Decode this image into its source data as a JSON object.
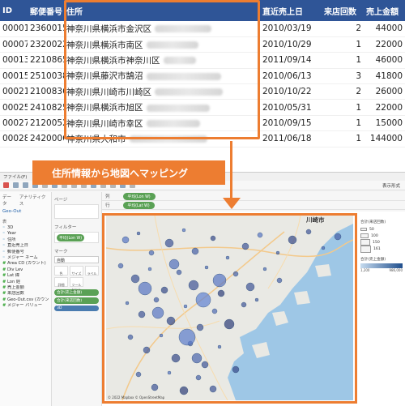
{
  "sheet": {
    "columns": [
      "ID",
      "郵便番号",
      "住所",
      "直近売上日",
      "来店回数",
      "売上金額"
    ],
    "rows": [
      {
        "id": "00001",
        "zip": "2360015",
        "addr": "神奈川県横浜市金沢区",
        "date": "2010/03/19",
        "visits": "2",
        "sales": "44000"
      },
      {
        "id": "00007",
        "zip": "2320022",
        "addr": "神奈川県横浜市南区",
        "date": "2010/10/29",
        "visits": "1",
        "sales": "22000"
      },
      {
        "id": "00013",
        "zip": "2210865",
        "addr": "神奈川県横浜市神奈川区",
        "date": "2011/09/14",
        "visits": "1",
        "sales": "46000"
      },
      {
        "id": "00015",
        "zip": "2510038",
        "addr": "神奈川県藤沢市鵠沼",
        "date": "2010/06/13",
        "visits": "3",
        "sales": "41800"
      },
      {
        "id": "00021",
        "zip": "2100836",
        "addr": "神奈川県川崎市川崎区",
        "date": "2010/10/22",
        "visits": "2",
        "sales": "26000"
      },
      {
        "id": "00025",
        "zip": "2410825",
        "addr": "神奈川県横浜市旭区",
        "date": "2010/05/31",
        "visits": "1",
        "sales": "22000"
      },
      {
        "id": "00027",
        "zip": "2120052",
        "addr": "神奈川県川崎市幸区",
        "date": "2010/09/15",
        "visits": "1",
        "sales": "15000"
      },
      {
        "id": "00028",
        "zip": "2420006",
        "addr": "神奈川県大和市",
        "date": "2011/06/18",
        "visits": "1",
        "sales": "144000"
      }
    ]
  },
  "callout": {
    "label": "住所情報から地図へマッピング",
    "color": "#ed7d31"
  },
  "app": {
    "menu": [
      "ファイル(F)"
    ],
    "show_me": "表示形式",
    "data_pane": {
      "tabs": [
        "データ",
        "アナリティクス"
      ],
      "datasource": "Geo-Out",
      "section_label": "表",
      "dimensions": [
        "3D",
        "Year",
        "住所",
        "直近売上日",
        "郵便番号",
        "メジャー ネーム"
      ],
      "measures": [
        "Area CD (カウント)",
        "Div Lev",
        "Lat 緯",
        "Lon 経",
        "売上金額",
        "来店回数",
        "Geo-Out.csv (カウント)",
        "メジャー バリュー"
      ]
    },
    "cards": {
      "pages": "ページ",
      "filters": "フィルター",
      "filter_pill": "平均(Lon W)",
      "marks": "マーク",
      "mark_type": "自動",
      "mark_buttons": [
        "色",
        "サイズ",
        "ラベル",
        "詳細",
        "ツールヒント"
      ],
      "mark_pills": [
        "合計(売上金額)",
        "合計(来店回数)",
        "3D"
      ]
    },
    "shelves": {
      "columns_label": "列",
      "rows_label": "行",
      "columns_pill": "平均(Lon W)",
      "rows_pill": "平均(Lat W)"
    }
  },
  "map": {
    "city_label": "川崎市",
    "copyright": "© 2022 Mapbox © OpenStreetMap",
    "sea_color": "#9ec7e6",
    "land_color": "#e9e9e4"
  },
  "legend": {
    "size_title": "合計(来店回数)",
    "size_values": [
      "50",
      "100",
      "150",
      "161"
    ],
    "color_title": "合計(売上金額)",
    "color_min": "1,200",
    "color_max": "986,000"
  }
}
